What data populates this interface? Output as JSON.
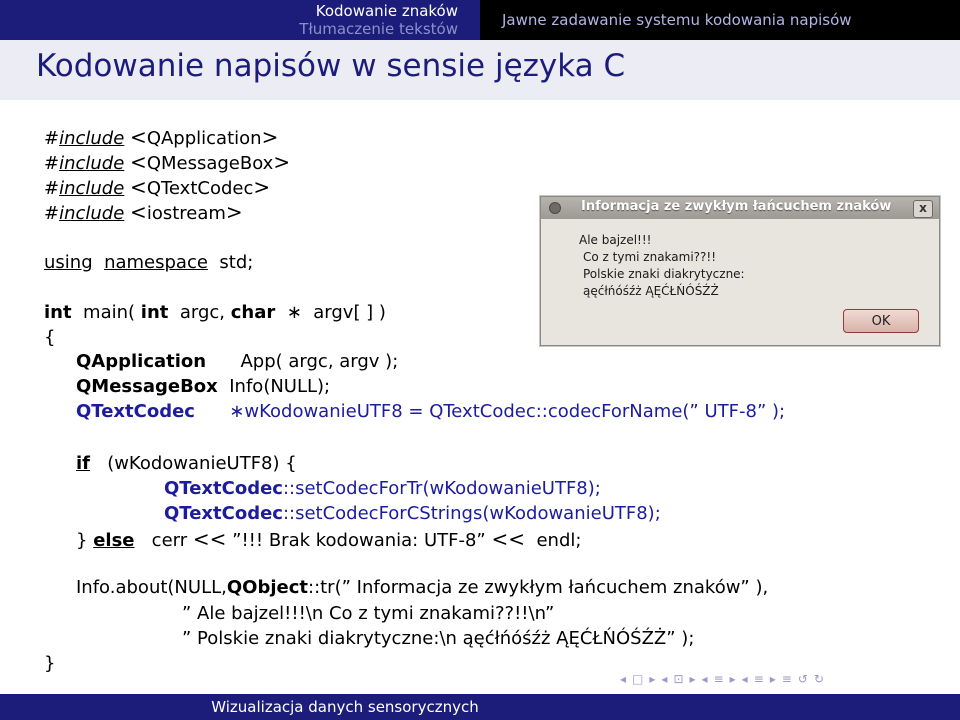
{
  "header": {
    "section_current": "Kodowanie znaków",
    "section_next": "Tłumaczenie tekstów",
    "subsection": "Jawne zadawanie systemu kodowania napisów"
  },
  "frame_title": "Kodowanie napisów w sensie języka C",
  "code": {
    "hash": "#",
    "include": "include",
    "inc1": "QApplication",
    "inc2": "QMessageBox",
    "inc3": "QTextCodec",
    "inc4": "iostream",
    "lt": "<",
    "gt": ">",
    "using": "using",
    "namespace": "namespace",
    "std": "std;",
    "int1": "int",
    "main": "main(",
    "int2": "int",
    "argc": "argc,",
    "char": "char",
    "star": "∗",
    "argv": "argv[ ] )",
    "open_brace": "{",
    "qapp_type": "QApplication",
    "qapp_rest": "App( argc, argv );",
    "qmsg_type": "QMessageBox",
    "qmsg_rest": "Info(NULL);",
    "qtc_type": "QTextCodec",
    "qtc_rest": "∗wKodowanieUTF8 = QTextCodec::codecForName(” UTF-8” );",
    "if": "if",
    "if_rest": "(wKodowanieUTF8) {",
    "set1_type": "QTextCodec",
    "set1_rest": "::setCodecForTr(wKodowanieUTF8);",
    "set2_type": "QTextCodec",
    "set2_rest": "::setCodecForCStrings(wKodowanieUTF8);",
    "close_else": "}",
    "else": "else",
    "cerr": "cerr",
    "shl": "<<",
    "cerr_str": "”!!! Brak kodowania: UTF-8”",
    "endl": "endl;",
    "info_a": "Info.about(NULL,",
    "info_obj": "QObject",
    "info_b": "::tr(” Informacja ze zwykłym łańcuchem znaków” ),",
    "info_line2": "” Ale bajzel!!!\\n Co z tymi znakami??!!\\n”",
    "info_line3": "” Polskie znaki diakrytyczne:\\n ąęćłńóśźż ĄĘĆŁŃÓŚŹŻ” );",
    "close_brace": "}"
  },
  "dialog": {
    "title": "Informacja ze zwykłym łańcuchem znaków",
    "close": "x",
    "lines": [
      "Ale bajzel!!!",
      "Co z tymi znakami??!!",
      "Polskie znaki diakrytyczne:",
      "ąęćłńóśźż ĄĘĆŁŃÓŚŹŻ"
    ],
    "ok": "OK"
  },
  "footer": "Wizualizacja danych sensorycznych",
  "nav": {
    "icons": [
      "◂",
      "□",
      "▸",
      "◂",
      "⊡",
      "▸",
      "◂",
      "≡",
      "▸",
      "◂",
      "≡",
      "▸",
      "≡",
      "↺",
      "↻"
    ]
  }
}
